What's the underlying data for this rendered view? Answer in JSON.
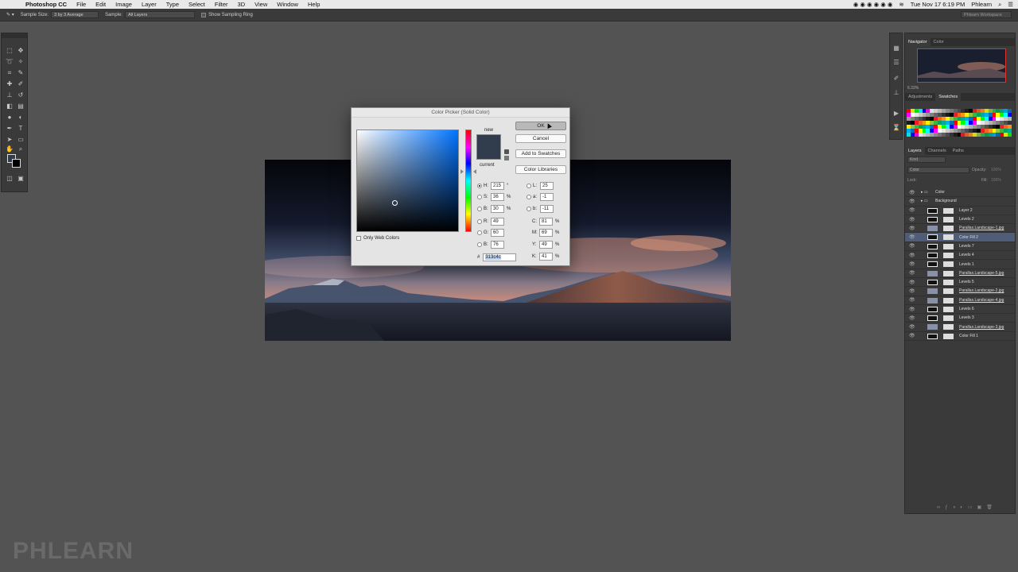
{
  "menubar": {
    "app": "Photoshop CC",
    "items": [
      "File",
      "Edit",
      "Image",
      "Layer",
      "Type",
      "Select",
      "Filter",
      "3D",
      "View",
      "Window",
      "Help"
    ],
    "datetime": "Tue Nov 17  6:19 PM",
    "user": "Phlearn"
  },
  "options_bar": {
    "sample_size_label": "Sample Size:",
    "sample_size_value": "3 by 3 Average",
    "sample_label": "Sample:",
    "sample_value": "All Layers",
    "show_ring_label": "Show Sampling Ring",
    "workspace": "Phlearn Workspace"
  },
  "navigator": {
    "tabs": [
      "Navigator",
      "Color"
    ],
    "zoom": "6.33%"
  },
  "swatches_panel": {
    "tabs": [
      "Adjustments",
      "Swatches"
    ],
    "colors": [
      "#ff0000",
      "#ffff00",
      "#00ff00",
      "#00ffff",
      "#0000ff",
      "#ff00ff",
      "#ffffff",
      "#e6e6e6",
      "#cccccc",
      "#b3b3b3",
      "#999999",
      "#808080",
      "#666666",
      "#4d4d4d",
      "#333333",
      "#1a1a1a",
      "#000000",
      "#ee1d24",
      "#f26522",
      "#f7941d",
      "#fff200",
      "#8dc63f",
      "#39b54a",
      "#00a651",
      "#00a99d",
      "#00aeef",
      "#0072bc"
    ]
  },
  "layers_panel": {
    "tabs": [
      "Layers",
      "Channels",
      "Paths"
    ],
    "kind": "Kind",
    "blend": "Color",
    "opacity_label": "Opacity:",
    "opacity": "100%",
    "lock_label": "Lock:",
    "fill_label": "Fill:",
    "fill": "100%",
    "layers": [
      {
        "name": "Color",
        "type": "group"
      },
      {
        "name": "Background",
        "type": "group"
      },
      {
        "name": "Layer 2",
        "type": "layer"
      },
      {
        "name": "Levels 2",
        "type": "adj"
      },
      {
        "name": "Parallax.Landscape-1.jpg",
        "type": "link"
      },
      {
        "name": "Color Fill 2",
        "type": "adj",
        "selected": true
      },
      {
        "name": "Levels 7",
        "type": "adj"
      },
      {
        "name": "Levels 4",
        "type": "adj"
      },
      {
        "name": "Levels 1",
        "type": "adj"
      },
      {
        "name": "Parallax.Landscape-5.jpg",
        "type": "link"
      },
      {
        "name": "Levels 5",
        "type": "adj"
      },
      {
        "name": "Parallax.Landscape-2.jpg",
        "type": "link"
      },
      {
        "name": "Parallax.Landscape-4.jpg",
        "type": "link"
      },
      {
        "name": "Levels 6",
        "type": "adj"
      },
      {
        "name": "Levels 3",
        "type": "adj"
      },
      {
        "name": "Parallax.Landscape-3.jpg",
        "type": "link"
      },
      {
        "name": "Color Fill 1",
        "type": "adj"
      }
    ]
  },
  "color_picker": {
    "title": "Color Picker (Solid Color)",
    "ok": "OK",
    "cancel": "Cancel",
    "add_to_swatches": "Add to Swatches",
    "color_libraries": "Color Libraries",
    "new_label": "new",
    "current_label": "current",
    "only_web_colors": "Only Web Colors",
    "fields": {
      "H": {
        "label": "H:",
        "value": "215",
        "unit": "°"
      },
      "S": {
        "label": "S:",
        "value": "36",
        "unit": "%"
      },
      "B": {
        "label": "B:",
        "value": "30",
        "unit": "%"
      },
      "R": {
        "label": "R:",
        "value": "49"
      },
      "G": {
        "label": "G:",
        "value": "60"
      },
      "Bl": {
        "label": "B:",
        "value": "76"
      },
      "L": {
        "label": "L:",
        "value": "25"
      },
      "a": {
        "label": "a:",
        "value": "-1"
      },
      "b": {
        "label": "b:",
        "value": "-11"
      },
      "C": {
        "label": "C:",
        "value": "81",
        "unit": "%"
      },
      "M": {
        "label": "M:",
        "value": "69",
        "unit": "%"
      },
      "Y": {
        "label": "Y:",
        "value": "49",
        "unit": "%"
      },
      "K": {
        "label": "K:",
        "value": "41",
        "unit": "%"
      }
    },
    "hex_label": "#",
    "hex": "313c4c",
    "color": "#313c4c"
  },
  "watermark": "PHLEARN"
}
